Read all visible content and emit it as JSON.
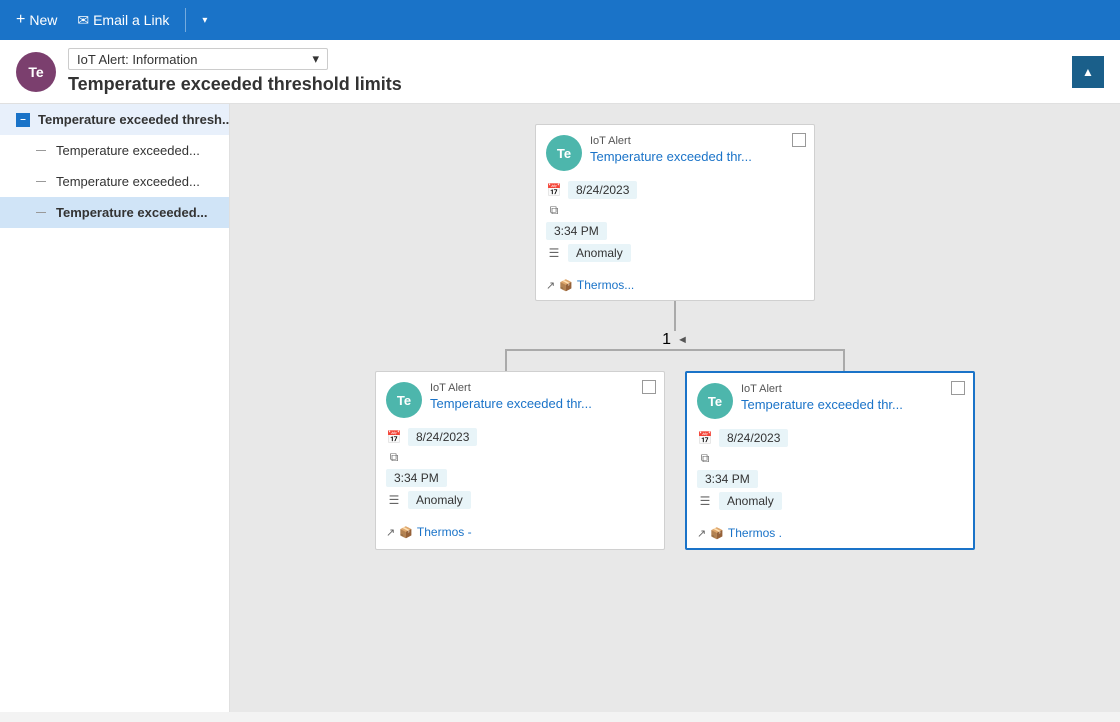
{
  "toolbar": {
    "new_label": "New",
    "email_label": "Email a Link",
    "new_icon": "+",
    "email_icon": "✉",
    "chevron_icon": "▾"
  },
  "header": {
    "avatar_text": "Te",
    "avatar_bg": "#7b3f6e",
    "dropdown_label": "IoT Alert: Information",
    "title": "Temperature exceeded threshold limits",
    "collapse_icon": "▲"
  },
  "sidebar": {
    "items": [
      {
        "label": "Temperature exceeded thresh...",
        "level": "top",
        "active": true,
        "selected": false
      },
      {
        "label": "Temperature exceeded...",
        "level": "child",
        "active": false,
        "selected": false
      },
      {
        "label": "Temperature exceeded...",
        "level": "child",
        "active": false,
        "selected": false
      },
      {
        "label": "Temperature exceeded...",
        "level": "child",
        "active": false,
        "selected": true
      }
    ]
  },
  "cards": {
    "top": {
      "avatar": "Te",
      "type": "IoT Alert",
      "title": "Temperature exceeded thr...",
      "date": "8/24/2023",
      "time": "3:34 PM",
      "status": "Anomaly",
      "link": "Thermos..."
    },
    "bottom_left": {
      "avatar": "Te",
      "type": "IoT Alert",
      "title": "Temperature exceeded thr...",
      "date": "8/24/2023",
      "time": "3:34 PM",
      "status": "Anomaly",
      "link": "Thermos -"
    },
    "bottom_right": {
      "avatar": "Te",
      "type": "IoT Alert",
      "title": "Temperature exceeded thr...",
      "date": "8/24/2023",
      "time": "3:34 PM",
      "status": "Anomaly",
      "link": "Thermos ."
    }
  },
  "pagination": {
    "current": "1",
    "arrow": "◄"
  }
}
